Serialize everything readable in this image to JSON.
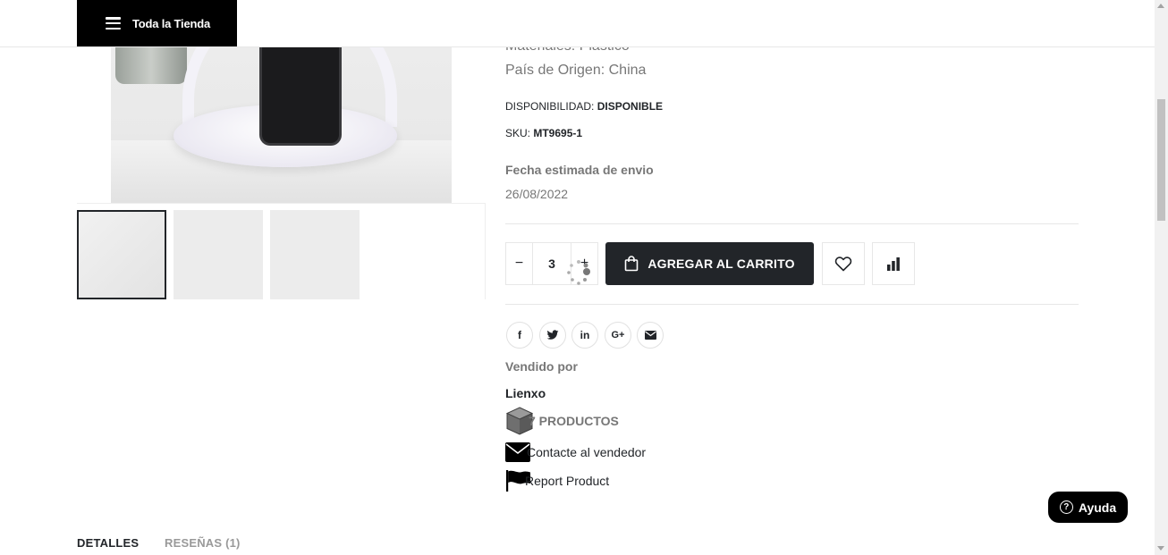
{
  "topbar": {
    "store_label": "Toda la Tienda"
  },
  "product": {
    "materials": "Materiales: Plástico",
    "origin": "País de Origen: China",
    "availability_label": "DISPONIBILIDAD:",
    "availability_value": "DISPONIBLE",
    "sku_label": "SKU:",
    "sku_value": "MT9695-1",
    "shipping_title": "Fecha estimada de envio",
    "shipping_date": "26/08/2022"
  },
  "actions": {
    "minus": "−",
    "quantity": "3",
    "plus": "+",
    "add_to_cart": "AGREGAR AL CARRITO"
  },
  "share_icons": [
    "facebook-icon",
    "twitter-icon",
    "linkedin-icon",
    "google-plus-icon",
    "email-icon"
  ],
  "share_glyphs": {
    "facebook": "f",
    "linkedin": "in",
    "googleplus": "G+"
  },
  "vendor": {
    "sold_by": "Vendido por",
    "name": "Lienxo",
    "products": "7 PRODUCTOS",
    "contact": "Contacte al vendedor",
    "report": "Report Product"
  },
  "help": {
    "label": "Ayuda",
    "glyph": "?"
  },
  "tabs": [
    {
      "label": "DETALLES"
    },
    {
      "label": "RESEÑAS",
      "count": "(1)"
    }
  ],
  "colors": {
    "primary": "#222529",
    "muted": "#777777",
    "black": "#000000"
  }
}
